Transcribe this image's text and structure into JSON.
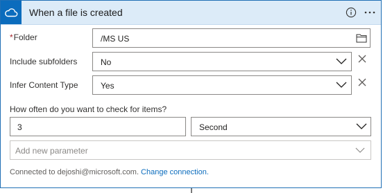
{
  "header": {
    "title": "When a file is created",
    "icon": "onedrive-cloud-icon",
    "accent": "#0b6cbd",
    "background": "#dcebf8"
  },
  "folder": {
    "label": "Folder",
    "required_marker": "*",
    "value": "/MS US",
    "icon": "folder-icon"
  },
  "include_subfolders": {
    "label": "Include subfolders",
    "value": "No"
  },
  "infer_content_type": {
    "label": "Infer Content Type",
    "value": "Yes"
  },
  "frequency": {
    "question": "How often do you want to check for items?",
    "interval": "3",
    "unit": "Second"
  },
  "add_parameter": {
    "placeholder": "Add new parameter"
  },
  "footer": {
    "connected_text": "Connected to dejoshi@microsoft.com.",
    "change_link": "Change connection."
  }
}
